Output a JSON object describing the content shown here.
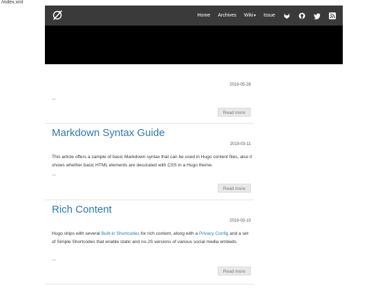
{
  "status_bar": {
    "url": "/index.xml"
  },
  "nav": {
    "brand_icon": "hugo-logo-icon",
    "links": [
      {
        "label": "Home"
      },
      {
        "label": "Archives"
      },
      {
        "label": "Wiki"
      },
      {
        "label": "Issue"
      }
    ],
    "wiki_caret": "▾",
    "icons": [
      "gitlab-icon",
      "github-icon",
      "twitter-icon",
      "rss-icon"
    ]
  },
  "posts": [
    {
      "title": "",
      "date": "2019-05-28",
      "summary": "",
      "ellipsis": "...",
      "read_more": "Read more"
    },
    {
      "title": "Markdown Syntax Guide",
      "date": "2019-03-11",
      "summary": "This article offers a sample of basic Markdown syntax that can be used in Hugo content files, also it shows whether basic HTML elements are decorated with CSS in a Hugo theme.",
      "ellipsis": "...",
      "read_more": "Read more"
    },
    {
      "title": "Rich Content",
      "date": "2019-03-10",
      "summary_parts": {
        "before_link1": "Hugo ships with several ",
        "link1": "Built-in Shortcodes",
        "between": " for rich content, along with a ",
        "link2": "Privacy Config",
        "after": " and a set of Simple Shortcodes that enable static and no-JS versions of various social media embeds."
      },
      "ellipsis": "...",
      "read_more": "Read more"
    }
  ],
  "colors": {
    "navbar": "#3a3a3a",
    "hero": "#000000",
    "link": "#2a7ab0"
  }
}
